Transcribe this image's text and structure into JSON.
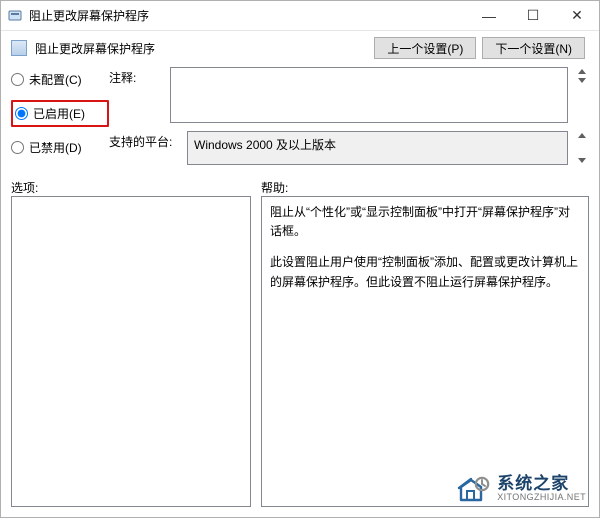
{
  "window": {
    "title": "阻止更改屏幕保护程序",
    "min_icon": "—",
    "max_icon": "☐",
    "close_icon": "✕"
  },
  "header": {
    "title": "阻止更改屏幕保护程序",
    "prev_button": "上一个设置(P)",
    "next_button": "下一个设置(N)"
  },
  "radios": {
    "not_configured": "未配置(C)",
    "enabled": "已启用(E)",
    "disabled": "已禁用(D)",
    "selected": "enabled"
  },
  "fields": {
    "comment_label": "注释:",
    "comment_value": "",
    "platform_label": "支持的平台:",
    "platform_value": "Windows 2000 及以上版本"
  },
  "lower": {
    "options_label": "选项:",
    "help_label": "帮助:",
    "help_text_p1": "阻止从“个性化”或“显示控制面板”中打开“屏幕保护程序”对话框。",
    "help_text_p2": "此设置阻止用户使用“控制面板”添加、配置或更改计算机上的屏幕保护程序。但此设置不阻止运行屏幕保护程序。"
  },
  "watermark": {
    "line1": "系统之家",
    "line2": "XITONGZHIJIA.NET"
  }
}
